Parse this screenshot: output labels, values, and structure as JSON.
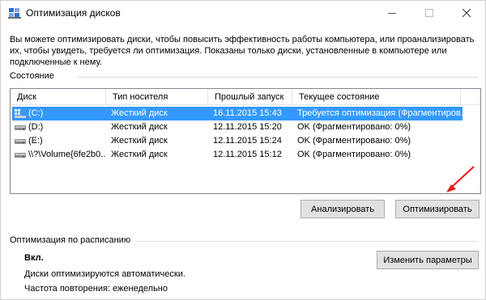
{
  "window": {
    "title": "Оптимизация дисков"
  },
  "description": "Вы можете оптимизировать диски, чтобы повысить эффективность работы  компьютера, или проанализировать их, чтобы увидеть, требуется ли оптимизация. Показаны только диски, установленные в компьютере или подключенные к нему.",
  "status_section": {
    "label": "Состояние"
  },
  "drives": {
    "columns": [
      "Диск",
      "Тип носителя",
      "Прошлый запуск",
      "Текущее состояние"
    ],
    "rows": [
      {
        "disk": "(C:)",
        "type": "Жесткий диск",
        "last_run": "16.11.2015 15:43",
        "status": "Требуется оптимизация (Фрагментиров...",
        "selected": true,
        "icon": "windows-drive-icon"
      },
      {
        "disk": "(D:)",
        "type": "Жесткий диск",
        "last_run": "12.11.2015 15:20",
        "status": "OK (Фрагментировано: 0%)",
        "selected": false,
        "icon": "hard-drive-icon"
      },
      {
        "disk": "(E:)",
        "type": "Жесткий диск",
        "last_run": "12.11.2015 15:24",
        "status": "OK (Фрагментировано: 0%)",
        "selected": false,
        "icon": "hard-drive-icon"
      },
      {
        "disk": "\\\\?\\Volume{6fe2b0...",
        "type": "Жесткий диск",
        "last_run": "12.11.2015 15:12",
        "status": "OK (Фрагментировано: 0%)",
        "selected": false,
        "icon": "hard-drive-icon"
      }
    ],
    "selection_color": "#3399ff"
  },
  "buttons": {
    "analyze": "Анализировать",
    "optimize": "Оптимизировать",
    "change_settings": "Изменить параметры"
  },
  "schedule_section": {
    "label": "Оптимизация по расписанию",
    "state": "Вкл.",
    "auto_text": "Диски оптимизируются автоматически.",
    "frequency": "Частота повторения: еженедельно"
  },
  "annotation": {
    "arrow_color": "#e8211c",
    "icon": "red-arrow-icon"
  }
}
